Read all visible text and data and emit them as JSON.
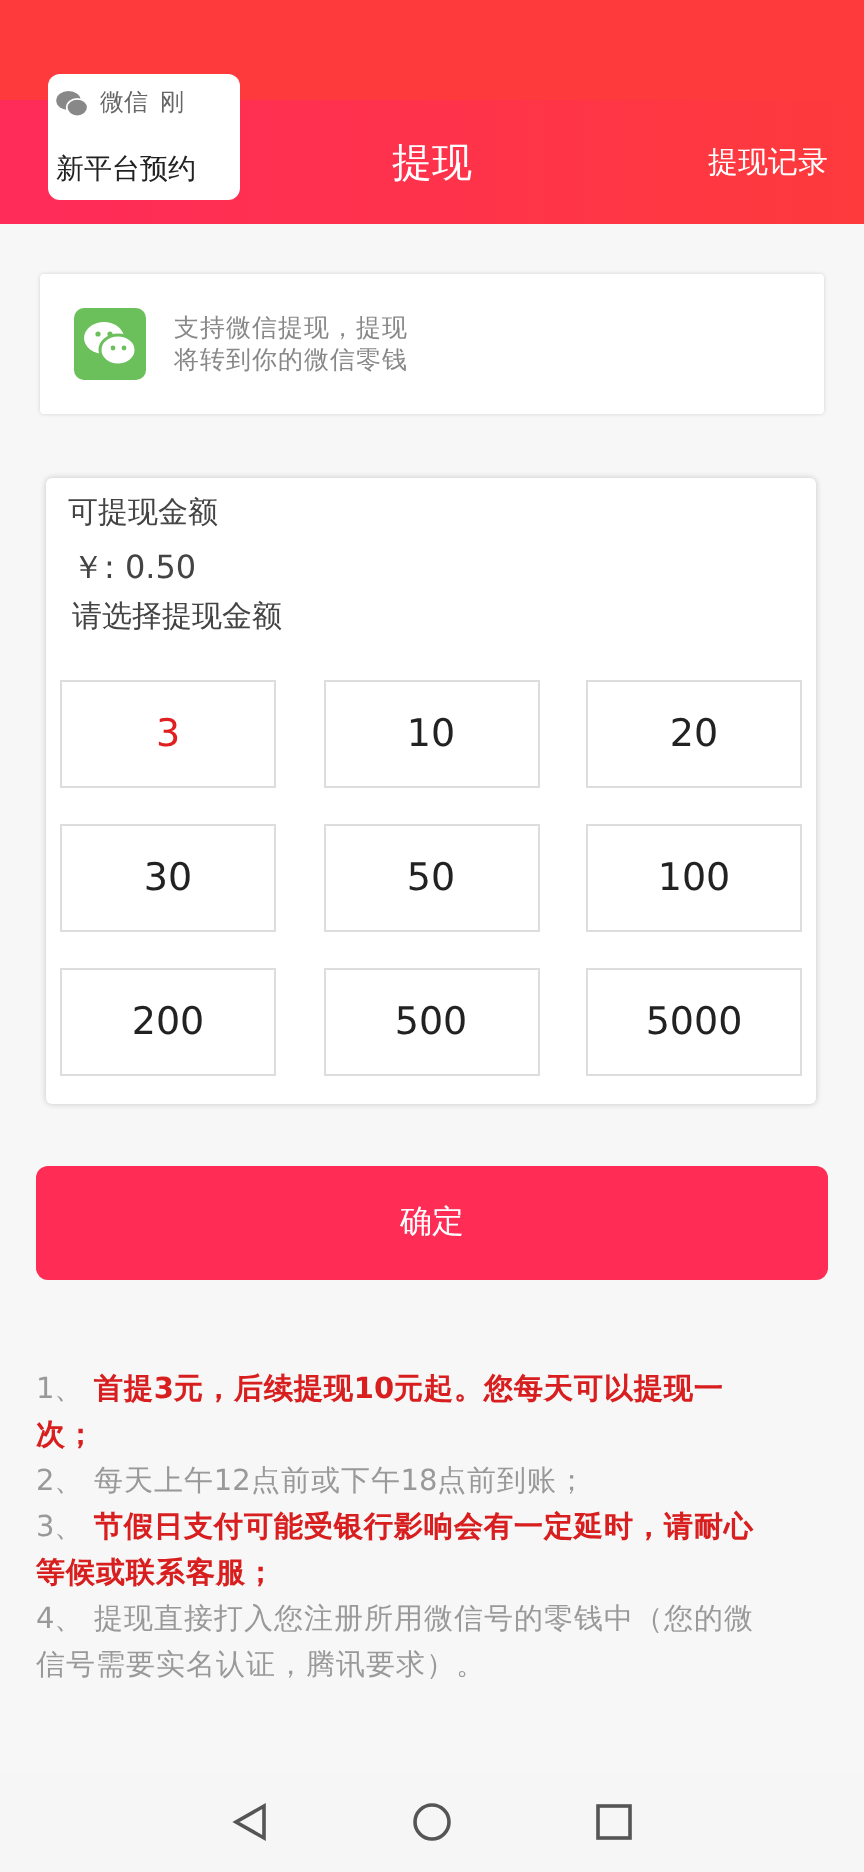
{
  "notification": {
    "app": "微信",
    "time": "刚",
    "title": "新平台预约"
  },
  "header": {
    "title": "提现",
    "action": "提现记录"
  },
  "info": {
    "text": "支持微信提现，提现将转到你的微信零钱"
  },
  "balance": {
    "label": "可提现金额",
    "amount": "￥: 0.50",
    "prompt": "请选择提现金额"
  },
  "amounts": [
    {
      "label": "3",
      "selected": true
    },
    {
      "label": "10",
      "selected": false
    },
    {
      "label": "20",
      "selected": false
    },
    {
      "label": "30",
      "selected": false
    },
    {
      "label": "50",
      "selected": false
    },
    {
      "label": "100",
      "selected": false
    },
    {
      "label": "200",
      "selected": false
    },
    {
      "label": "500",
      "selected": false
    },
    {
      "label": "5000",
      "selected": false
    }
  ],
  "confirm": "确定",
  "notes": [
    {
      "number": "1、",
      "text": "首提3元，后续提现10元起。您每天可以提现一次；",
      "emphasis": true
    },
    {
      "number": "2、",
      "text": "每天上午12点前或下午18点前到账；",
      "emphasis": false
    },
    {
      "number": "3、",
      "text": "节假日支付可能受银行影响会有一定延时，请耐心等候或联系客服；",
      "emphasis": true
    },
    {
      "number": "4、",
      "text": "提现直接打入您注册所用微信号的零钱中（您的微信号需要实名认证，腾讯要求）。",
      "emphasis": false
    }
  ]
}
